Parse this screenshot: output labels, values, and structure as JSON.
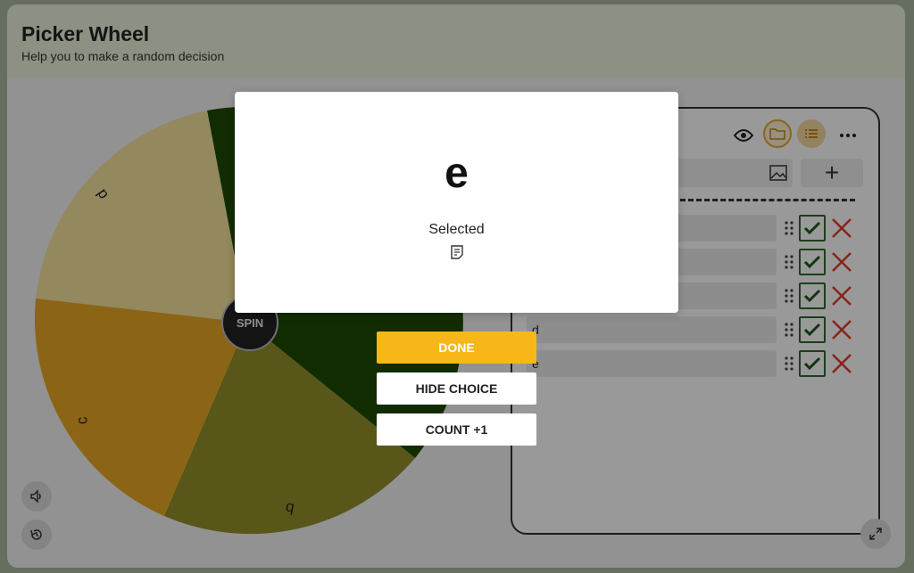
{
  "header": {
    "title": "Picker Wheel",
    "subtitle": "Help you to make a random decision"
  },
  "wheel": {
    "spin_label": "SPIN",
    "labels": [
      "d",
      "c",
      "b"
    ],
    "colors": {
      "segment_e": "#1f4a03",
      "segment_d": "#f7e39d",
      "segment_c": "#e8a824",
      "segment_b": "#93902b"
    }
  },
  "controls": {
    "sound_icon": "speaker-icon",
    "history_icon": "history-icon",
    "fullscreen_icon": "expand-icon"
  },
  "panel": {
    "toolbar_icons": [
      "eye-icon",
      "folder-icon",
      "list-icon",
      "more-icon"
    ],
    "add_label": "+",
    "entries": [
      {
        "text": ""
      },
      {
        "text": ""
      },
      {
        "text": ""
      },
      {
        "text": "d"
      },
      {
        "text": "e"
      }
    ]
  },
  "modal": {
    "result": "e",
    "status": "Selected",
    "done_label": "DONE",
    "hide_label": "HIDE CHOICE",
    "count_label": "COUNT +1",
    "accent": "#f7b719"
  }
}
